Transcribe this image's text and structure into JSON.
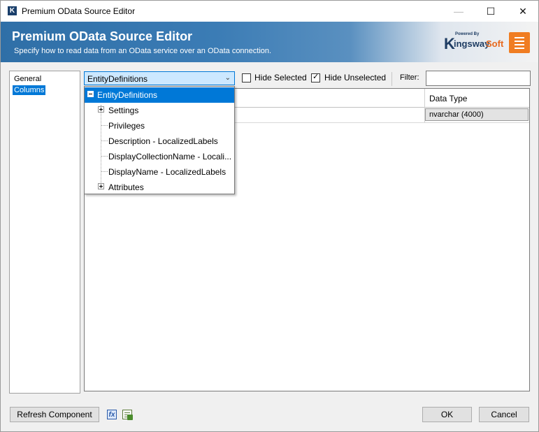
{
  "window": {
    "title": "Premium OData Source Editor",
    "app_icon": "K",
    "minimize_icon": "—",
    "maximize_icon": "☐",
    "close_icon": "✕"
  },
  "banner": {
    "title": "Premium OData Source Editor",
    "subtitle": "Specify how to read data from an OData service over an OData connection.",
    "logo_powered": "Powered By",
    "logo_k": "K",
    "logo_ingsway": "ingsway",
    "logo_soft": "Soft"
  },
  "nav": {
    "items": [
      {
        "label": "General"
      },
      {
        "label": "Columns"
      }
    ]
  },
  "toolbar": {
    "entity_combo": "EntityDefinitions",
    "hide_selected_label": "Hide Selected",
    "hide_selected_checked": false,
    "hide_unselected_label": "Hide Unselected",
    "hide_unselected_checked": true,
    "filter_label": "Filter:",
    "filter_value": ""
  },
  "dropdown": {
    "items": [
      {
        "label": "EntityDefinitions",
        "expander": "-"
      },
      {
        "label": "Settings",
        "expander": "+"
      },
      {
        "label": "Privileges",
        "expander": ""
      },
      {
        "label": "Description - LocalizedLabels",
        "expander": ""
      },
      {
        "label": "DisplayCollectionName - Locali...",
        "expander": ""
      },
      {
        "label": "DisplayName - LocalizedLabels",
        "expander": ""
      },
      {
        "label": "Attributes",
        "expander": "+"
      }
    ]
  },
  "grid": {
    "columns": [
      "Data Type"
    ],
    "rows": [
      {
        "data_type": "nvarchar (4000)"
      }
    ]
  },
  "footer": {
    "refresh_label": "Refresh Component",
    "fx_icon": "fx",
    "ok_label": "OK",
    "cancel_label": "Cancel"
  }
}
